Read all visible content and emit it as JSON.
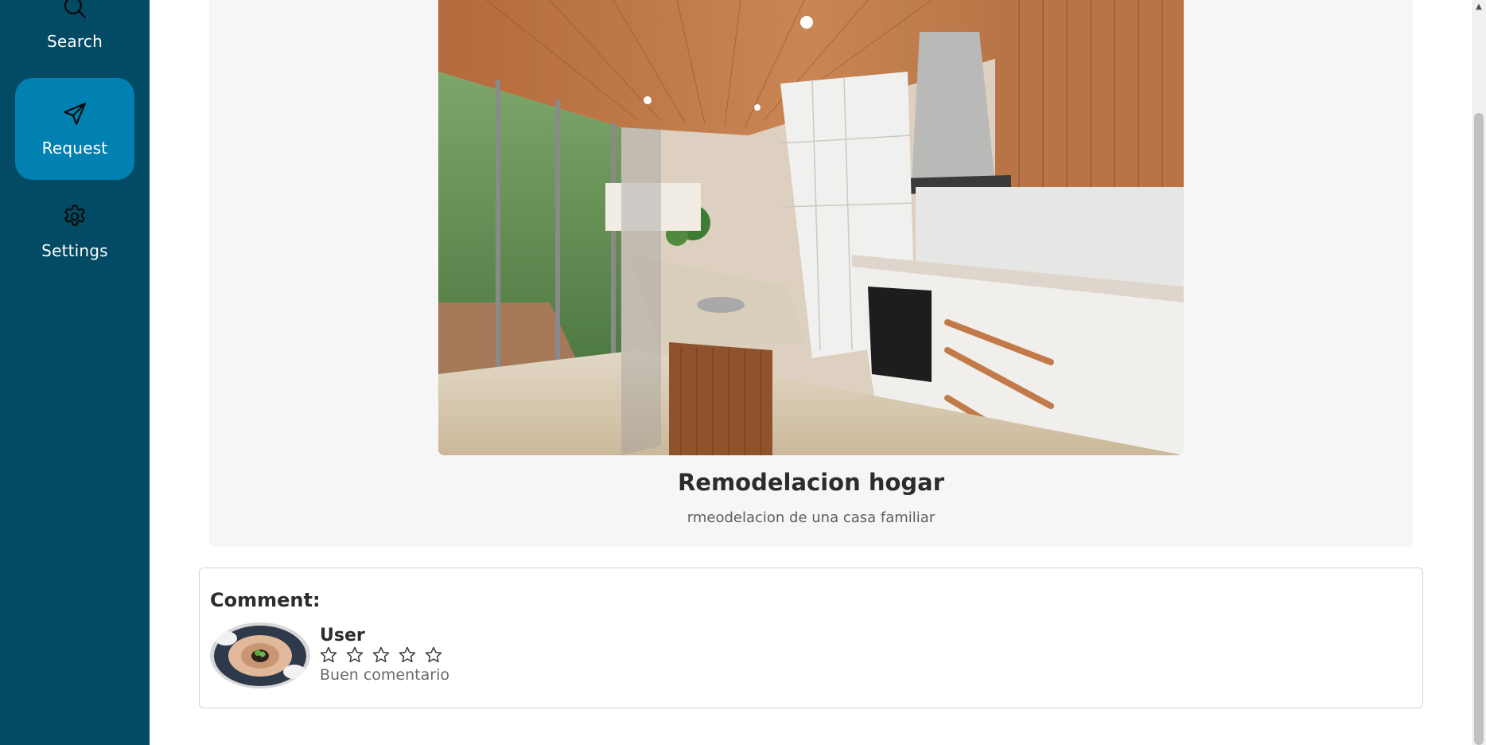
{
  "sidebar": {
    "items": [
      {
        "label": "Search",
        "icon": "search-icon"
      },
      {
        "label": "Request",
        "icon": "send-icon",
        "active": true
      },
      {
        "label": "Settings",
        "icon": "gear-icon"
      }
    ],
    "bg_color": "#034a64",
    "active_color": "#0181b2"
  },
  "post": {
    "image": "kitchen-photo",
    "title": "Remodelacion hogar",
    "description": "rmeodelacion de una casa familiar"
  },
  "comments": {
    "heading": "Comment:",
    "items": [
      {
        "user": "User",
        "avatar": "hands-with-plant-photo",
        "rating": 0,
        "max_rating": 5,
        "text": "Buen comentario"
      }
    ]
  }
}
